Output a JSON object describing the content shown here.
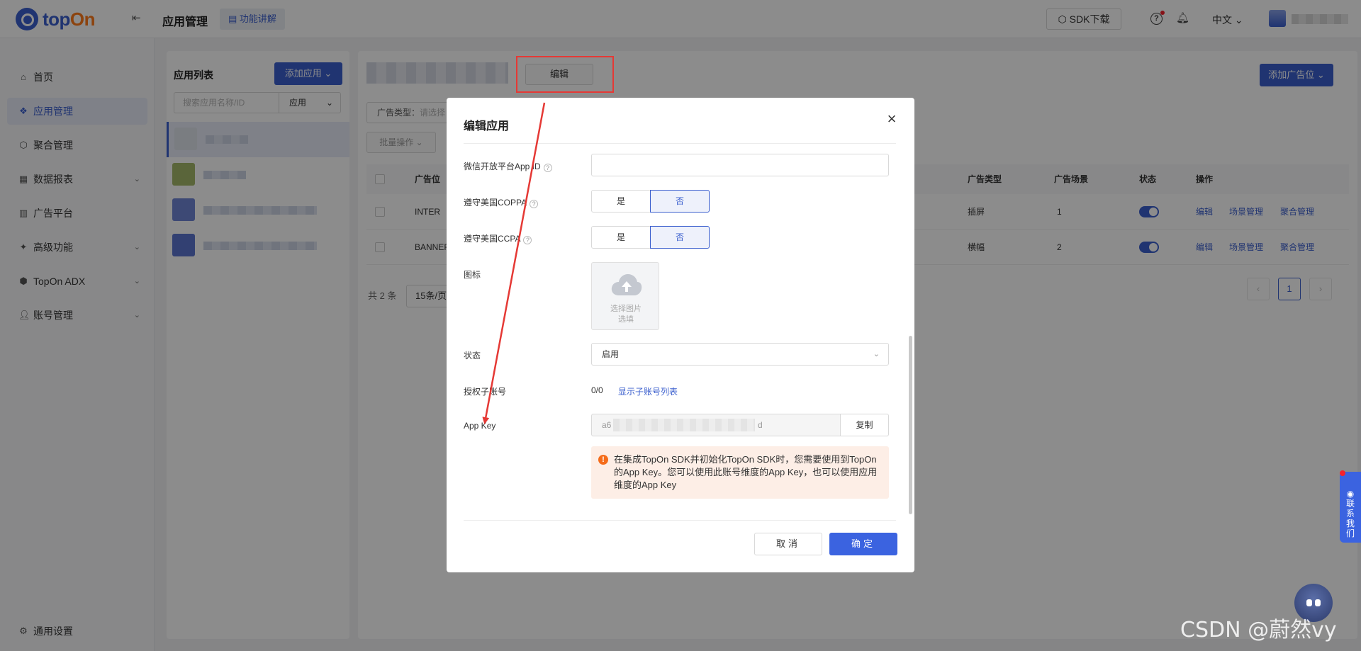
{
  "header": {
    "logo_top": "top",
    "logo_on": "On",
    "page_title": "应用管理",
    "func_btn": "功能讲解",
    "sdk_btn": "SDK下载",
    "lang": "中文"
  },
  "sidebar": {
    "items": [
      {
        "label": "首页",
        "icon": "home-icon"
      },
      {
        "label": "应用管理",
        "icon": "diamond-icon"
      },
      {
        "label": "聚合管理",
        "icon": "hexagon-icon"
      },
      {
        "label": "数据报表",
        "icon": "report-icon"
      },
      {
        "label": "广告平台",
        "icon": "chart-icon"
      },
      {
        "label": "高级功能",
        "icon": "star-icon"
      },
      {
        "label": "TopOn ADX",
        "icon": "adx-icon"
      },
      {
        "label": "账号管理",
        "icon": "user-icon"
      }
    ],
    "settings": "通用设置"
  },
  "app_list": {
    "title": "应用列表",
    "add_btn": "添加应用",
    "search_placeholder": "搜索应用名称/ID",
    "search_type": "应用"
  },
  "main": {
    "edit_btn": "编辑",
    "add_slot_btn": "添加广告位",
    "adtype_label": "广告类型：",
    "adtype_placeholder": "请选择",
    "batch_btn": "批量操作",
    "columns": {
      "slot": "广告位",
      "type": "广告类型",
      "scene": "广告场景",
      "status": "状态",
      "ops": "操作"
    },
    "rows": [
      {
        "slot": "INTER",
        "type": "插屏",
        "scene": "1",
        "op1": "编辑",
        "op2": "场景管理",
        "op3": "聚合管理"
      },
      {
        "slot": "BANNER",
        "type": "横幅",
        "scene": "2",
        "op1": "编辑",
        "op2": "场景管理",
        "op3": "聚合管理"
      }
    ],
    "total": "共 2 条",
    "page_size": "15条/页",
    "current_page": "1"
  },
  "dialog": {
    "title": "编辑应用",
    "wechat_label": "微信开放平台App ID",
    "coppa_label": "遵守美国COPPA",
    "ccpa_label": "遵守美国CCPA",
    "yes": "是",
    "no": "否",
    "icon_label": "图标",
    "upload_line1": "选择图片",
    "upload_line2": "选填",
    "status_label": "状态",
    "status_value": "启用",
    "auth_label": "授权子账号",
    "auth_count": "0/0",
    "auth_link": "显示子账号列表",
    "appkey_label": "App Key",
    "appkey_start": "a6",
    "appkey_end": "d",
    "copy_btn": "复制",
    "notice": "在集成TopOn SDK并初始化TopOn SDK时，您需要使用到TopOn的App Key。您可以使用此账号维度的App Key，也可以使用应用维度的App Key",
    "cancel_btn": "取消",
    "ok_btn": "确定"
  },
  "float": {
    "contact": "联系我们",
    "watermark": "CSDN @蔚然vy"
  },
  "colors": {
    "brand": "#3b5fce",
    "highlight": "#e53935",
    "warn": "#f56c1a"
  }
}
